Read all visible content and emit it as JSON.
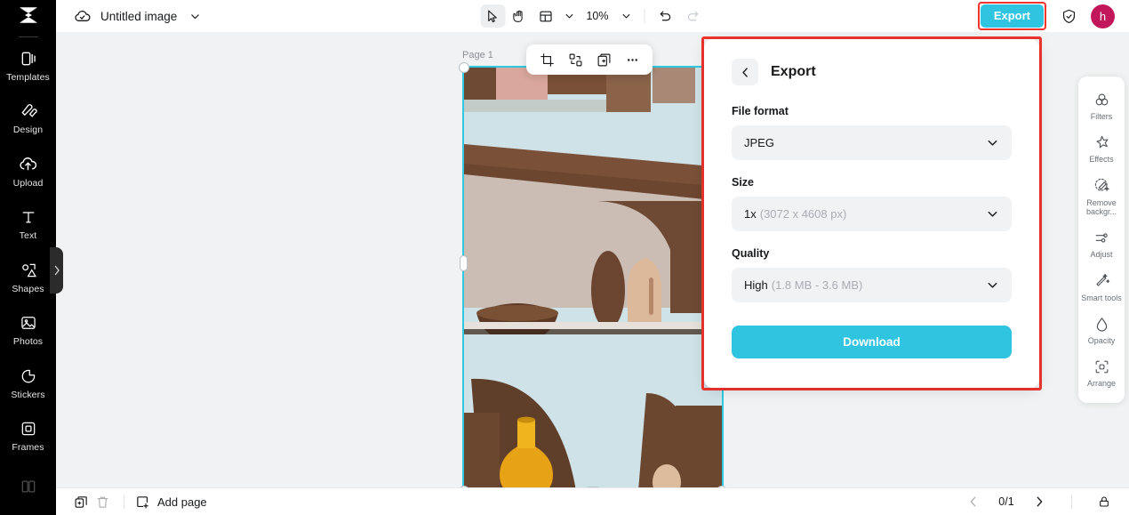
{
  "app": {
    "logo_icon": "capcut-logo-icon"
  },
  "sidebar": {
    "items": [
      {
        "label": "Templates",
        "icon": "templates-icon"
      },
      {
        "label": "Design",
        "icon": "design-icon"
      },
      {
        "label": "Upload",
        "icon": "upload-icon"
      },
      {
        "label": "Text",
        "icon": "text-icon"
      },
      {
        "label": "Shapes",
        "icon": "shapes-icon"
      },
      {
        "label": "Photos",
        "icon": "photos-icon"
      },
      {
        "label": "Stickers",
        "icon": "stickers-icon"
      },
      {
        "label": "Frames",
        "icon": "frames-icon"
      },
      {
        "label": "",
        "icon": "background-icon"
      }
    ],
    "collapse_icon": "chevron-right-icon"
  },
  "topbar": {
    "cloud_icon": "cloud-saved-icon",
    "doc_title": "Untitled image",
    "title_caret_icon": "chevron-down-icon",
    "tools": [
      {
        "name": "select-tool",
        "icon": "cursor-arrow-icon",
        "active": true
      },
      {
        "name": "hand-tool",
        "icon": "hand-icon",
        "active": false
      },
      {
        "name": "layout-tool",
        "icon": "layout-grid-icon",
        "active": false
      }
    ],
    "layout_caret_icon": "chevron-down-icon",
    "zoom_level": "10%",
    "zoom_caret_icon": "chevron-down-icon",
    "undo_icon": "undo-icon",
    "redo_icon": "redo-icon",
    "export_label": "Export",
    "shield_icon": "shield-check-icon",
    "avatar_initial": "h"
  },
  "canvas": {
    "page_label": "Page 1",
    "float_toolbar": [
      {
        "name": "crop-button",
        "icon": "crop-icon"
      },
      {
        "name": "replace-button",
        "icon": "swap-icon"
      },
      {
        "name": "duplicate-button",
        "icon": "duplicate-icon"
      },
      {
        "name": "more-button",
        "icon": "ellipsis-icon"
      }
    ]
  },
  "export_panel": {
    "back_icon": "chevron-left-icon",
    "title": "Export",
    "fields": [
      {
        "name": "file-format",
        "label": "File format",
        "value": "JPEG",
        "sub": "",
        "chevron_icon": "chevron-down-icon"
      },
      {
        "name": "size",
        "label": "Size",
        "value": "1x",
        "sub": "(3072 x 4608 px)",
        "chevron_icon": "chevron-down-icon"
      },
      {
        "name": "quality",
        "label": "Quality",
        "value": "High",
        "sub": "(1.8 MB - 3.6 MB)",
        "chevron_icon": "chevron-down-icon"
      }
    ],
    "download_label": "Download"
  },
  "right_rail": {
    "items": [
      {
        "label": "Filters",
        "icon": "filters-icon"
      },
      {
        "label": "Effects",
        "icon": "effects-icon"
      },
      {
        "label": "Remove backgr...",
        "icon": "remove-background-icon"
      },
      {
        "label": "Adjust",
        "icon": "adjust-icon"
      },
      {
        "label": "Smart tools",
        "icon": "smart-tools-icon"
      },
      {
        "label": "Opacity",
        "icon": "opacity-icon"
      },
      {
        "label": "Arrange",
        "icon": "arrange-icon"
      }
    ]
  },
  "bottombar": {
    "duplicate_page_icon": "duplicate-page-icon",
    "delete_page_icon": "trash-icon",
    "add_page_label": "Add page",
    "add_page_icon": "add-page-icon",
    "prev_icon": "chevron-left-icon",
    "page_indicator": "0/1",
    "next_icon": "chevron-right-icon",
    "lock_icon": "lock-icon"
  },
  "colors": {
    "accent": "#2fc4e0",
    "highlight_box": "#f0342f",
    "avatar_bg": "#c2185b",
    "rail_bg": "#000000",
    "canvas_bg": "#f0f2f3",
    "selection": "#2ec9e0"
  }
}
